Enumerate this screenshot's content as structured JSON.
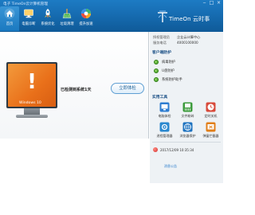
{
  "window": {
    "title": "电子 TimeOn云计算机管理"
  },
  "nav": {
    "items": [
      {
        "label": "首页",
        "icon": "home-icon",
        "active": true
      },
      {
        "label": "电脑诊断",
        "icon": "monitor-icon",
        "active": false
      },
      {
        "label": "系统优化",
        "icon": "rocket-icon",
        "active": false
      },
      {
        "label": "垃圾清理",
        "icon": "broom-icon",
        "active": false
      },
      {
        "label": "提升加速",
        "icon": "speed-icon",
        "active": false
      }
    ]
  },
  "brand": {
    "name": "TimeOn 云时事",
    "accent": "#1569ad"
  },
  "main": {
    "monitor_os": "Windows 10",
    "status_message": "已检测到系统1天",
    "try_button": "立即体检"
  },
  "right": {
    "info": [
      {
        "key": "授权管理员",
        "value": "企业云计算中心"
      },
      {
        "key": "服务电话",
        "value": "4000100000"
      }
    ],
    "protect_title": "客户端防护",
    "protect_items": [
      {
        "label": "病毒防护"
      },
      {
        "label": "U盘防护"
      },
      {
        "label": "系统防护助手"
      }
    ],
    "tools_title": "实用工具",
    "tools": [
      {
        "label": "电脑体检",
        "icon": "checkup-icon",
        "color": "#2e7dd1"
      },
      {
        "label": "文件粉碎",
        "icon": "shredder-icon",
        "color": "#3c9b3c"
      },
      {
        "label": "定时关机",
        "icon": "timer-icon",
        "color": "#d84a3a"
      },
      {
        "label": "进程管理器",
        "icon": "process-icon",
        "color": "#2a88cf"
      },
      {
        "label": "浏览器保护",
        "icon": "browser-icon",
        "color": "#1e73c0"
      },
      {
        "label": "弹窗拦截器",
        "icon": "popup-block-icon",
        "color": "#e17f1a"
      }
    ],
    "news": {
      "date": "2017/12/09 10:35:34",
      "title": "",
      "link_text": "消息公告"
    }
  }
}
